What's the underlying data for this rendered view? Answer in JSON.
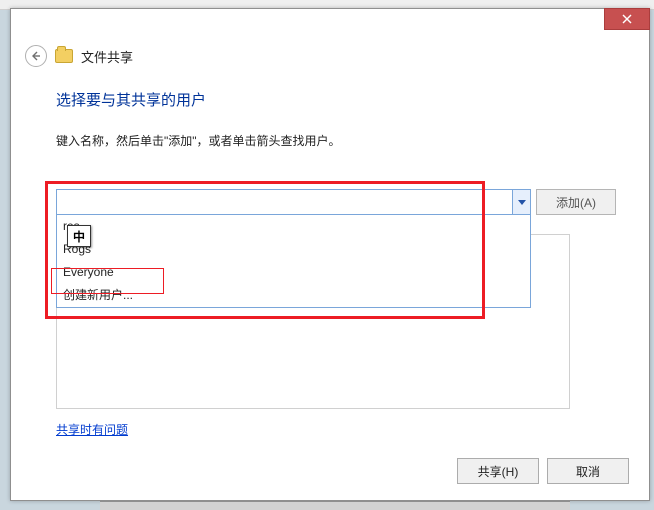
{
  "window": {
    "title": "文件共享"
  },
  "main": {
    "heading": "选择要与其共享的用户",
    "sub_text": "键入名称，然后单击\"添加\"，或者单击箭头查找用户。"
  },
  "combo": {
    "value": "",
    "options": [
      "res",
      "Rogs",
      "Everyone",
      "创建新用户..."
    ]
  },
  "ime": {
    "char": "中"
  },
  "buttons": {
    "add": "添加(A)",
    "share": "共享(H)",
    "cancel": "取消"
  },
  "help_link": "共享时有问题"
}
